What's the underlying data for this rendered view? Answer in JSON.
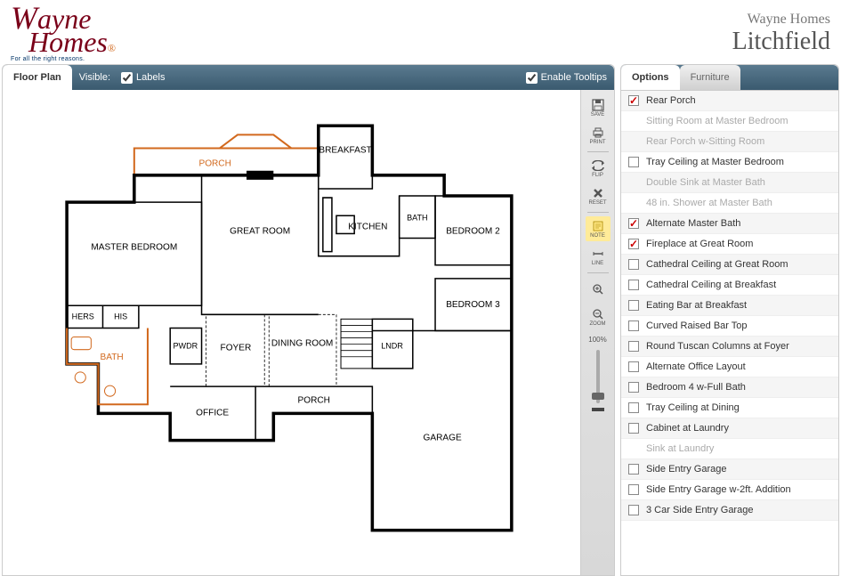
{
  "header": {
    "logo_main": "Wayne Homes",
    "logo_sub": "For all the right reasons.",
    "company": "Wayne Homes",
    "model": "Litchfield"
  },
  "left": {
    "tab": "Floor Plan",
    "visible_label": "Visible:",
    "labels_label": "Labels",
    "tooltips_label": "Enable Tooltips"
  },
  "rooms": {
    "porch_top": "PORCH",
    "breakfast": "BREAKFAST",
    "master": "MASTER BEDROOM",
    "great": "GREAT ROOM",
    "kitchen": "KITCHEN",
    "bath_sm": "BATH",
    "bed2": "BEDROOM 2",
    "hers": "HERS",
    "his": "HIS",
    "bath": "BATH",
    "pwdr": "PWDR",
    "foyer": "FOYER",
    "dining": "DINING ROOM",
    "lndr": "LNDR",
    "bed3": "BEDROOM 3",
    "office": "OFFICE",
    "porch_bot": "PORCH",
    "garage": "GARAGE"
  },
  "toolbar": {
    "save": "SAVE",
    "print": "PRINT",
    "flip": "FLIP",
    "reset": "RESET",
    "note": "NOTE",
    "line": "LINE",
    "zoom": "ZOOM",
    "zoom_pct": "100%"
  },
  "right": {
    "tab_options": "Options",
    "tab_furniture": "Furniture"
  },
  "options": [
    {
      "label": "Rear Porch",
      "checked": true,
      "enabled": true
    },
    {
      "label": "Sitting Room at Master Bedroom",
      "checked": false,
      "enabled": false
    },
    {
      "label": "Rear Porch w-Sitting Room",
      "checked": false,
      "enabled": false
    },
    {
      "label": "Tray Ceiling at Master Bedroom",
      "checked": false,
      "enabled": true
    },
    {
      "label": "Double Sink at Master Bath",
      "checked": false,
      "enabled": false
    },
    {
      "label": "48 in. Shower at Master Bath",
      "checked": false,
      "enabled": false
    },
    {
      "label": "Alternate Master Bath",
      "checked": true,
      "enabled": true
    },
    {
      "label": "Fireplace at Great Room",
      "checked": true,
      "enabled": true
    },
    {
      "label": "Cathedral Ceiling at Great Room",
      "checked": false,
      "enabled": true
    },
    {
      "label": "Cathedral Ceiling at Breakfast",
      "checked": false,
      "enabled": true
    },
    {
      "label": "Eating Bar at Breakfast",
      "checked": false,
      "enabled": true
    },
    {
      "label": "Curved Raised Bar Top",
      "checked": false,
      "enabled": true
    },
    {
      "label": "Round Tuscan Columns at Foyer",
      "checked": false,
      "enabled": true
    },
    {
      "label": "Alternate Office Layout",
      "checked": false,
      "enabled": true
    },
    {
      "label": "Bedroom 4 w-Full Bath",
      "checked": false,
      "enabled": true
    },
    {
      "label": "Tray Ceiling at Dining",
      "checked": false,
      "enabled": true
    },
    {
      "label": "Cabinet at Laundry",
      "checked": false,
      "enabled": true
    },
    {
      "label": "Sink at Laundry",
      "checked": false,
      "enabled": false
    },
    {
      "label": "Side Entry Garage",
      "checked": false,
      "enabled": true
    },
    {
      "label": "Side Entry Garage w-2ft. Addition",
      "checked": false,
      "enabled": true
    },
    {
      "label": "3 Car Side Entry Garage",
      "checked": false,
      "enabled": true
    }
  ]
}
